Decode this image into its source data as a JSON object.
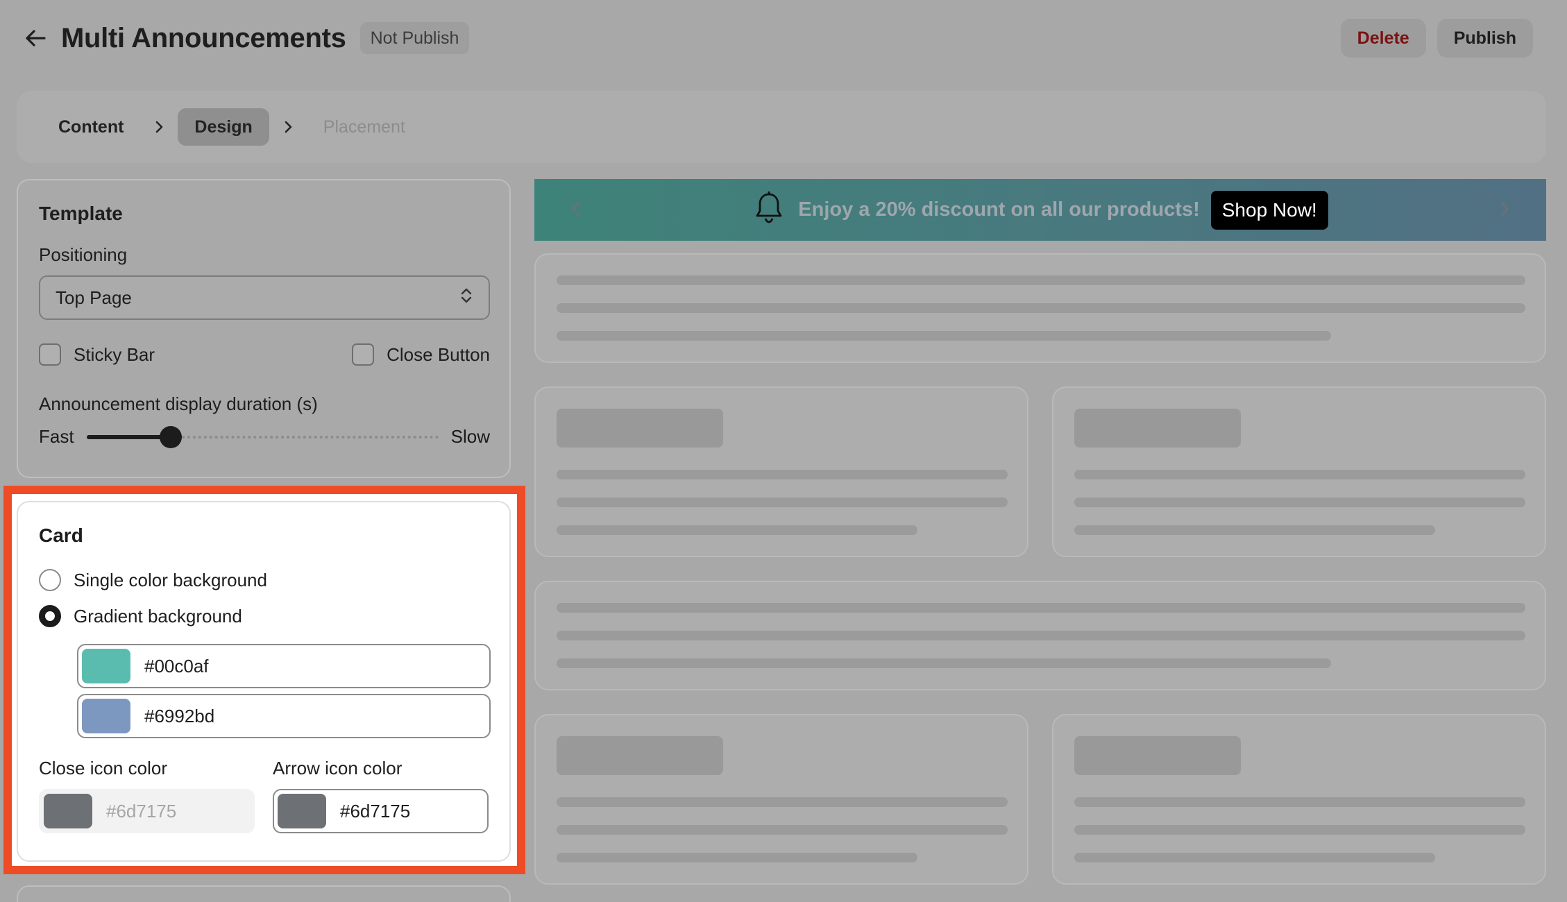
{
  "header": {
    "title": "Multi Announcements",
    "status": "Not Publish",
    "delete_label": "Delete",
    "publish_label": "Publish"
  },
  "steps": [
    {
      "label": "Content",
      "state": "done"
    },
    {
      "label": "Design",
      "state": "active"
    },
    {
      "label": "Placement",
      "state": "disabled"
    }
  ],
  "template": {
    "title": "Template",
    "positioning_label": "Positioning",
    "positioning_value": "Top Page",
    "sticky_bar_label": "Sticky Bar",
    "close_button_label": "Close Button",
    "duration_label": "Announcement display duration (s)",
    "fast_label": "Fast",
    "slow_label": "Slow",
    "duration_fraction": 0.24
  },
  "card": {
    "title": "Card",
    "single_label": "Single color background",
    "gradient_label": "Gradient background",
    "gradient_color_1": "#00c0af",
    "gradient_color_2": "#6992bd",
    "close_icon_label": "Close icon color",
    "close_icon_value": "#6d7175",
    "arrow_icon_label": "Arrow icon color",
    "arrow_icon_value": "#6d7175"
  },
  "preview": {
    "banner_text": "Enjoy a 20% discount on all our products!",
    "shop_label": "Shop Now!"
  },
  "colors": {
    "highlight": "#ee4c26",
    "swatch_1": "#5abcaf",
    "swatch_2": "#7d98c0",
    "icon_swatch": "#6d7175"
  }
}
